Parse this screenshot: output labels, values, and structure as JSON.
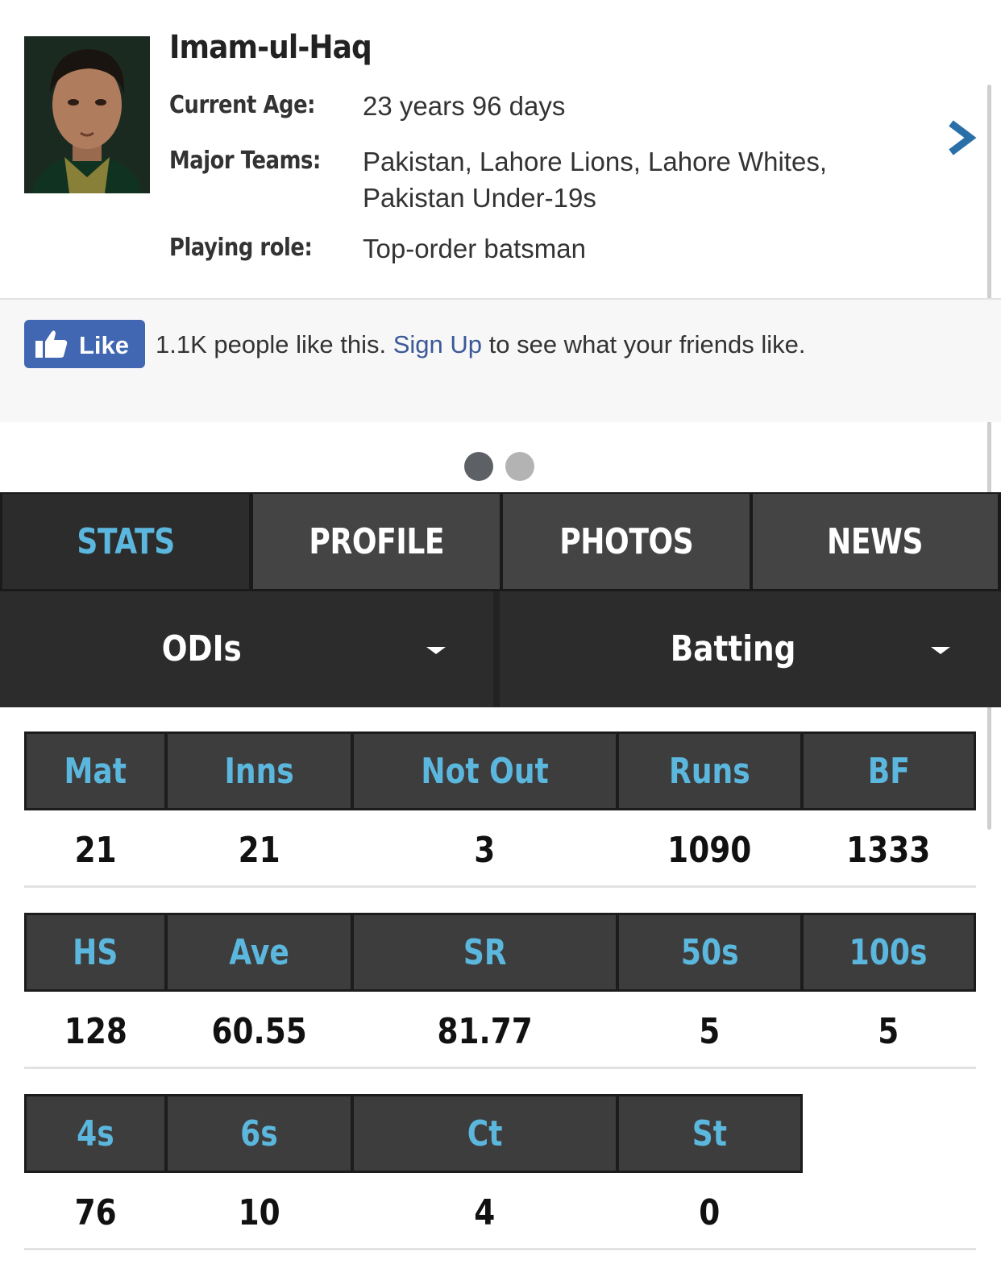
{
  "player": {
    "name": "Imam-ul-Haq",
    "info": [
      {
        "label": "Current Age:",
        "value": "23 years 96 days"
      },
      {
        "label": "Major Teams:",
        "value": "Pakistan, Lahore Lions, Lahore Whites, Pakistan Under-19s"
      },
      {
        "label": "Playing role:",
        "value": "Top-order batsman"
      }
    ],
    "next_icon": "chevron-right-icon"
  },
  "like_bar": {
    "button_label": "Like",
    "text_before": "1.1K people like this.",
    "link_text": "Sign Up",
    "text_after": "to see what your friends like.",
    "button_color": "#4267b2",
    "link_color": "#3b5998"
  },
  "carousel": {
    "active_index": 0,
    "count": 2
  },
  "tabs": [
    {
      "label": "STATS",
      "active": true
    },
    {
      "label": "PROFILE",
      "active": false
    },
    {
      "label": "PHOTOS",
      "active": false
    },
    {
      "label": "NEWS",
      "active": false
    }
  ],
  "filters": {
    "format": "ODIs",
    "category": "Batting"
  },
  "colors": {
    "accent": "#5bb7dd",
    "tab_bg": "#444444",
    "header_cell_bg": "#3d3d3d"
  },
  "stats": [
    {
      "headers": [
        "Mat",
        "Inns",
        "Not Out",
        "Runs",
        "BF"
      ],
      "values": [
        "21",
        "21",
        "3",
        "1090",
        "1333"
      ]
    },
    {
      "headers": [
        "HS",
        "Ave",
        "SR",
        "50s",
        "100s"
      ],
      "values": [
        "128",
        "60.55",
        "81.77",
        "5",
        "5"
      ]
    },
    {
      "headers": [
        "4s",
        "6s",
        "Ct",
        "St"
      ],
      "values": [
        "76",
        "10",
        "4",
        "0"
      ]
    }
  ]
}
